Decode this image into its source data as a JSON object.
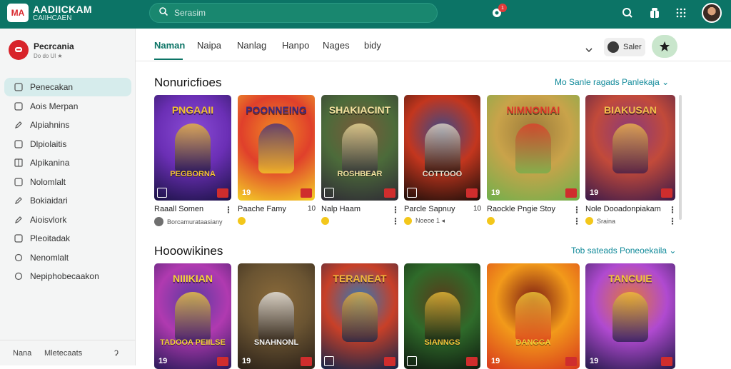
{
  "header": {
    "logo_badge": "MA",
    "logo_line1": "AADIICKAM",
    "logo_line2": "CAIIHCAEN",
    "search_placeholder": "Serasim",
    "notification_count": "1"
  },
  "sidebar": {
    "profile_name": "Pecrcania",
    "profile_sub": "Do do Ul ★",
    "items": [
      {
        "label": "Penecakan",
        "icon": "square-icon"
      },
      {
        "label": "Aois Merpan",
        "icon": "square-icon"
      },
      {
        "label": "Alpiahnins",
        "icon": "pencil-icon"
      },
      {
        "label": "Dlpiolaitis",
        "icon": "square-icon"
      },
      {
        "label": "Alpikanina",
        "icon": "grid-icon"
      },
      {
        "label": "Nolomlalt",
        "icon": "square-icon"
      },
      {
        "label": "Bokiaidari",
        "icon": "pencil-icon"
      },
      {
        "label": "Aioisvlork",
        "icon": "pencil-icon"
      },
      {
        "label": "Pleoitadak",
        "icon": "square-icon"
      },
      {
        "label": "Nenomlalt",
        "icon": "circle-icon"
      },
      {
        "label": "Nepiphobecaakon",
        "icon": "circle-icon"
      }
    ],
    "footer": {
      "left": "Nana",
      "middle": "Mletecaats",
      "right": "ʔ"
    }
  },
  "tabs": [
    "Naman",
    "Naipa",
    "Nanlag",
    "Hanpo",
    "Nages",
    "bidy"
  ],
  "toolbar": {
    "sort_label": "Saler"
  },
  "sections": [
    {
      "title": "Nonuricfioes",
      "link": "Mo Sanle ragads Panlekaja ⌄",
      "cards": [
        {
          "art_title": "PNGAAII",
          "art_sub": "PEGBORNA",
          "rank": "",
          "name": "Raaall Somen",
          "num": "⋮",
          "meta": "Borcamurataasiany",
          "meta_icon": "avatar"
        },
        {
          "art_title": "POONNEING",
          "art_sub": "",
          "rank": "19",
          "name": "Paache Famy",
          "num": "10",
          "meta": "",
          "meta_icon": "coin"
        },
        {
          "art_title": "SHAKIACINT",
          "art_sub": "ROSHBEAR",
          "rank": "",
          "name": "Nalp Haam",
          "num": "⋮",
          "meta": "",
          "meta_icon": "coin"
        },
        {
          "art_title": "",
          "art_sub": "COTTOOO",
          "rank": "",
          "name": "Parcle Sapnuy",
          "num": "10",
          "meta": "Noeoe 1 ◂",
          "meta_icon": "coin"
        },
        {
          "art_title": "NIMNONIAI",
          "art_sub": "",
          "rank": "19",
          "name": "Raockle Pngie Stoy",
          "num": "⋮",
          "meta": "",
          "meta_icon": "coin"
        },
        {
          "art_title": "BIAKUSAN",
          "art_sub": "",
          "rank": "19",
          "name": "Nole Dooadonpiakam",
          "num": "⋮",
          "meta": "Sraina",
          "meta_icon": "coin"
        }
      ]
    },
    {
      "title": "Hooowikines",
      "link": "Tob sateads Poneoekaila ⌄",
      "cards": [
        {
          "art_title": "NIIIKIAN",
          "art_sub": "TADOOA PEIILSE",
          "rank": "19"
        },
        {
          "art_title": "",
          "art_sub": "SNAHNONL",
          "rank": "19"
        },
        {
          "art_title": "TERANEAT",
          "art_sub": "",
          "rank": ""
        },
        {
          "art_title": "",
          "art_sub": "SIANNGS",
          "rank": ""
        },
        {
          "art_title": "",
          "art_sub": "DANGGA",
          "rank": "19"
        },
        {
          "art_title": "TANCUIE",
          "art_sub": "",
          "rank": "19"
        }
      ]
    }
  ],
  "colors": {
    "header": "#0c7466",
    "accent": "#0c7466",
    "link": "#118a9a",
    "active_nav": "#d6ecec"
  }
}
